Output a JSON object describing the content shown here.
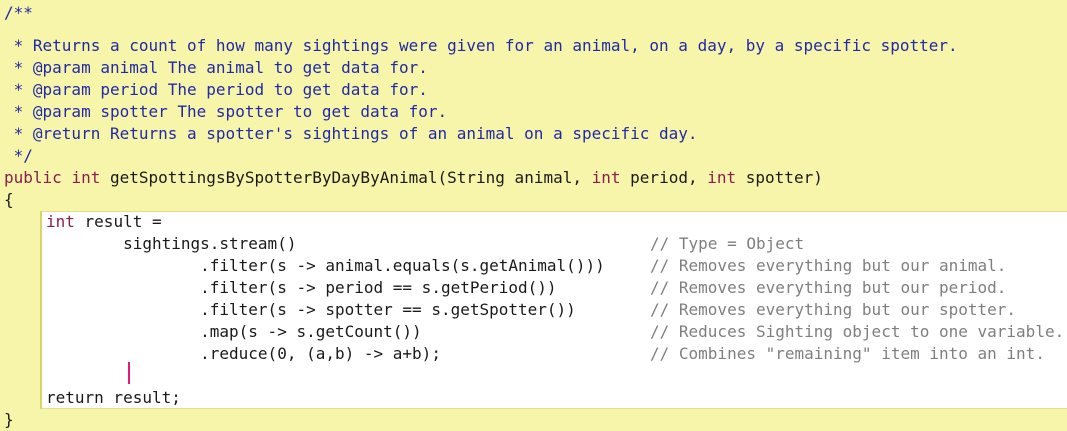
{
  "editor": {
    "doc_comment": [
      "/**",
      " * Returns a count of how many sightings were given for an animal, on a day, by a specific spotter.",
      " * @param animal The animal to get data for.",
      " * @param period The period to get data for.",
      " * @param spotter The spotter to get data for.",
      " * @return Returns a spotter's sightings of an animal on a specific day.",
      " */"
    ],
    "signature": {
      "kw_public": "public",
      "kw_int_return": "int",
      "name_and_param1": " getSpottingsBySpotterByDayByAnimal(String animal, ",
      "kw_int_period": "int",
      "param_period": " period, ",
      "kw_int_spotter": "int",
      "param_spotter": " spotter)"
    },
    "open_brace": "{",
    "close_brace": "}",
    "body": {
      "decl_kw": "int",
      "decl_rest": " result =",
      "code_lines": [
        "        sightings.stream()",
        "                .filter(s -> animal.equals(s.getAnimal()))",
        "                .filter(s -> period == s.getPeriod())",
        "                .filter(s -> spotter == s.getSpotter())",
        "                .map(s -> s.getCount())",
        "                .reduce(0, (a,b) -> a+b);"
      ],
      "comments": [
        "// Type = Object",
        "// Removes everything but our animal.",
        "// Removes everything but our period.",
        "// Removes everything but our spotter.",
        "// Reduces Sighting object to one variable.",
        "// Combines \"remaining\" item into an int."
      ],
      "return_stmt": "return result;"
    },
    "colors": {
      "background": "#f7f5aa",
      "doc_comment": "#1f2aa6",
      "keyword": "#8a1e4f",
      "line_comment": "#7f7f7f",
      "caret": "#e2197a"
    }
  }
}
